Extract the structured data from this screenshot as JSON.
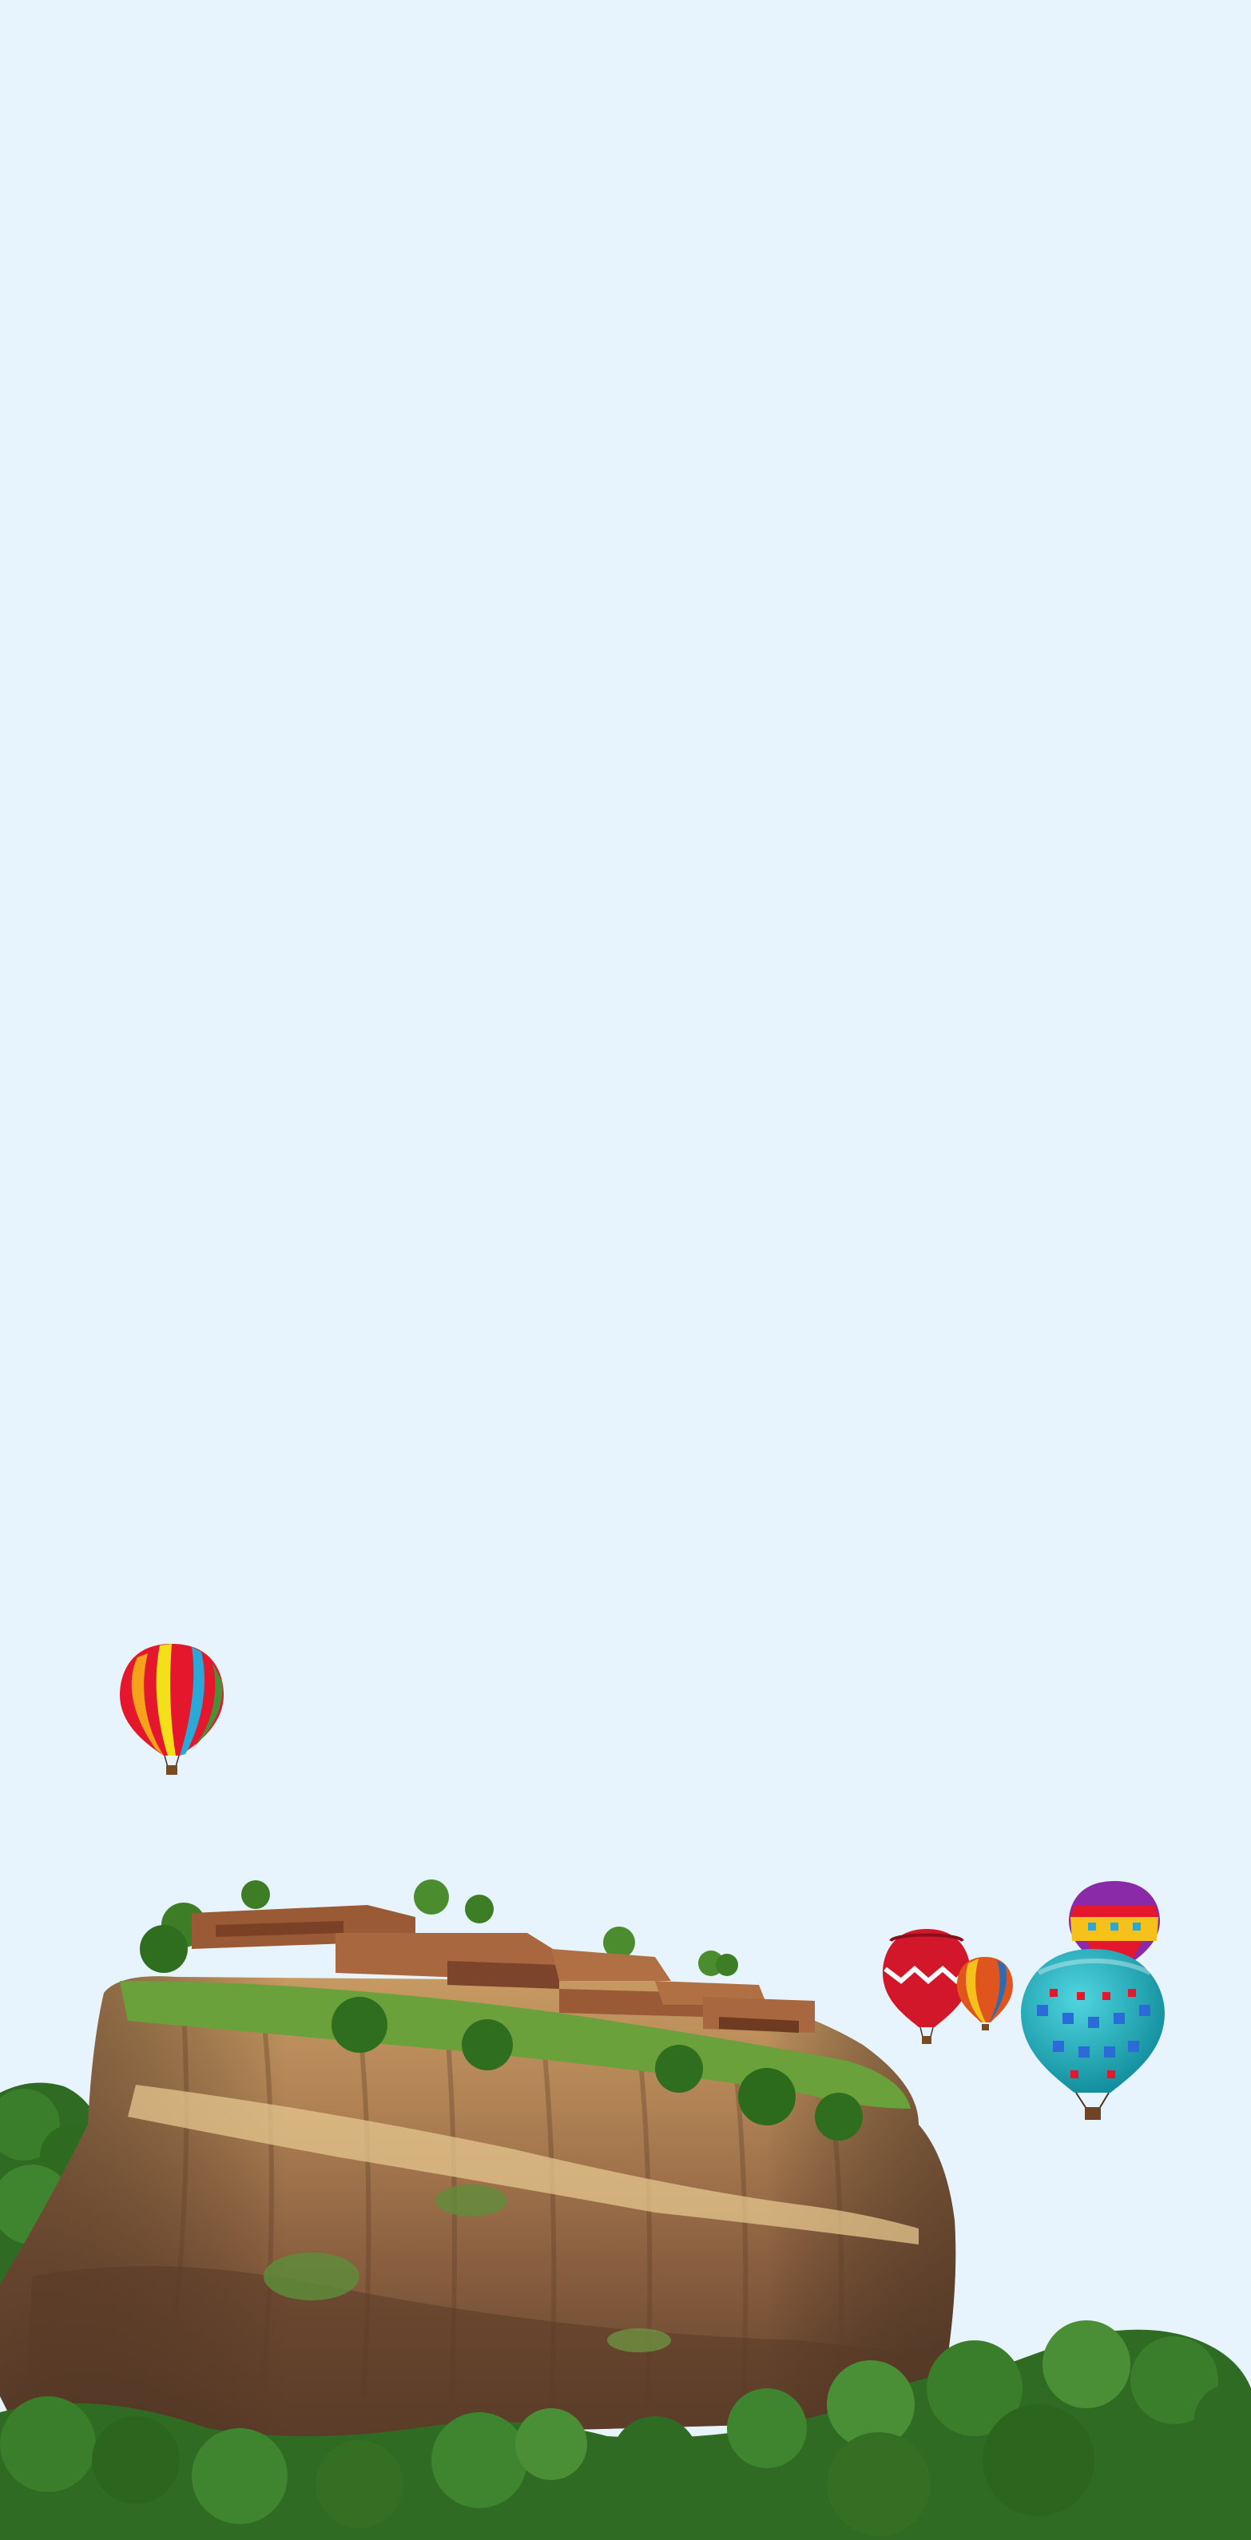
{
  "scene": {
    "description_colors": {
      "sky": "#e8f4fd",
      "rock_light": "#b98e5c",
      "rock_dark": "#6e4b33",
      "vegetation": "#3f7d2a",
      "ruins": "#a4623d"
    },
    "balloons": [
      {
        "name": "rainbow-balloon",
        "colors": [
          "#e4172d",
          "#f6a21a",
          "#f3e01b",
          "#2aa8d8",
          "#4a8f3a"
        ]
      },
      {
        "name": "red-chevron-balloon",
        "colors": [
          "#d3172a",
          "#ffffff"
        ]
      },
      {
        "name": "small-orange-balloon",
        "colors": [
          "#e0551d",
          "#f6c21a",
          "#2a6bb8"
        ]
      },
      {
        "name": "purple-yellow-balloon",
        "colors": [
          "#8a2aa8",
          "#f6c21a",
          "#e4172d"
        ]
      },
      {
        "name": "teal-balloon",
        "colors": [
          "#1fb4c0",
          "#2a6bd8",
          "#e4172d"
        ]
      }
    ]
  }
}
